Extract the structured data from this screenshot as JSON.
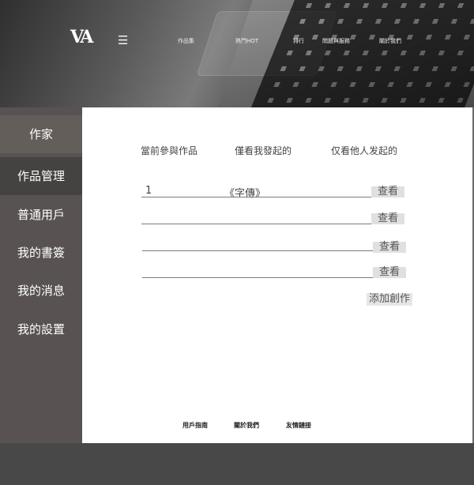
{
  "header": {
    "logo": "VA",
    "menu_icon": "☰",
    "nav": [
      "作品集",
      "熱門HOT",
      "排行",
      "問題與服務",
      "關於我們"
    ]
  },
  "sidebar": {
    "items": [
      {
        "label": "作家"
      },
      {
        "label": "作品管理"
      },
      {
        "label": "普通用戶"
      },
      {
        "label": "我的書簽"
      },
      {
        "label": "我的消息"
      },
      {
        "label": "我的設置"
      }
    ]
  },
  "main": {
    "filters": [
      "當前參與作品",
      "僅看我發起的",
      "仅看他人发起的"
    ],
    "rows": [
      {
        "index": "1",
        "title": "《字傳》",
        "action": "查看"
      },
      {
        "index": "",
        "title": "",
        "action": "查看"
      },
      {
        "index": "",
        "title": "",
        "action": "查看"
      },
      {
        "index": "",
        "title": "",
        "action": "查看"
      }
    ],
    "add_button": "添加創作"
  },
  "footer": {
    "links": [
      "用戶指南",
      "關於我們",
      "友情鏈接"
    ]
  },
  "colors": {
    "sidebar_bg": "#585252",
    "sidebar_active": "#454242",
    "main_bg": "#ffffff",
    "button_bg": "#e0e0e0"
  }
}
